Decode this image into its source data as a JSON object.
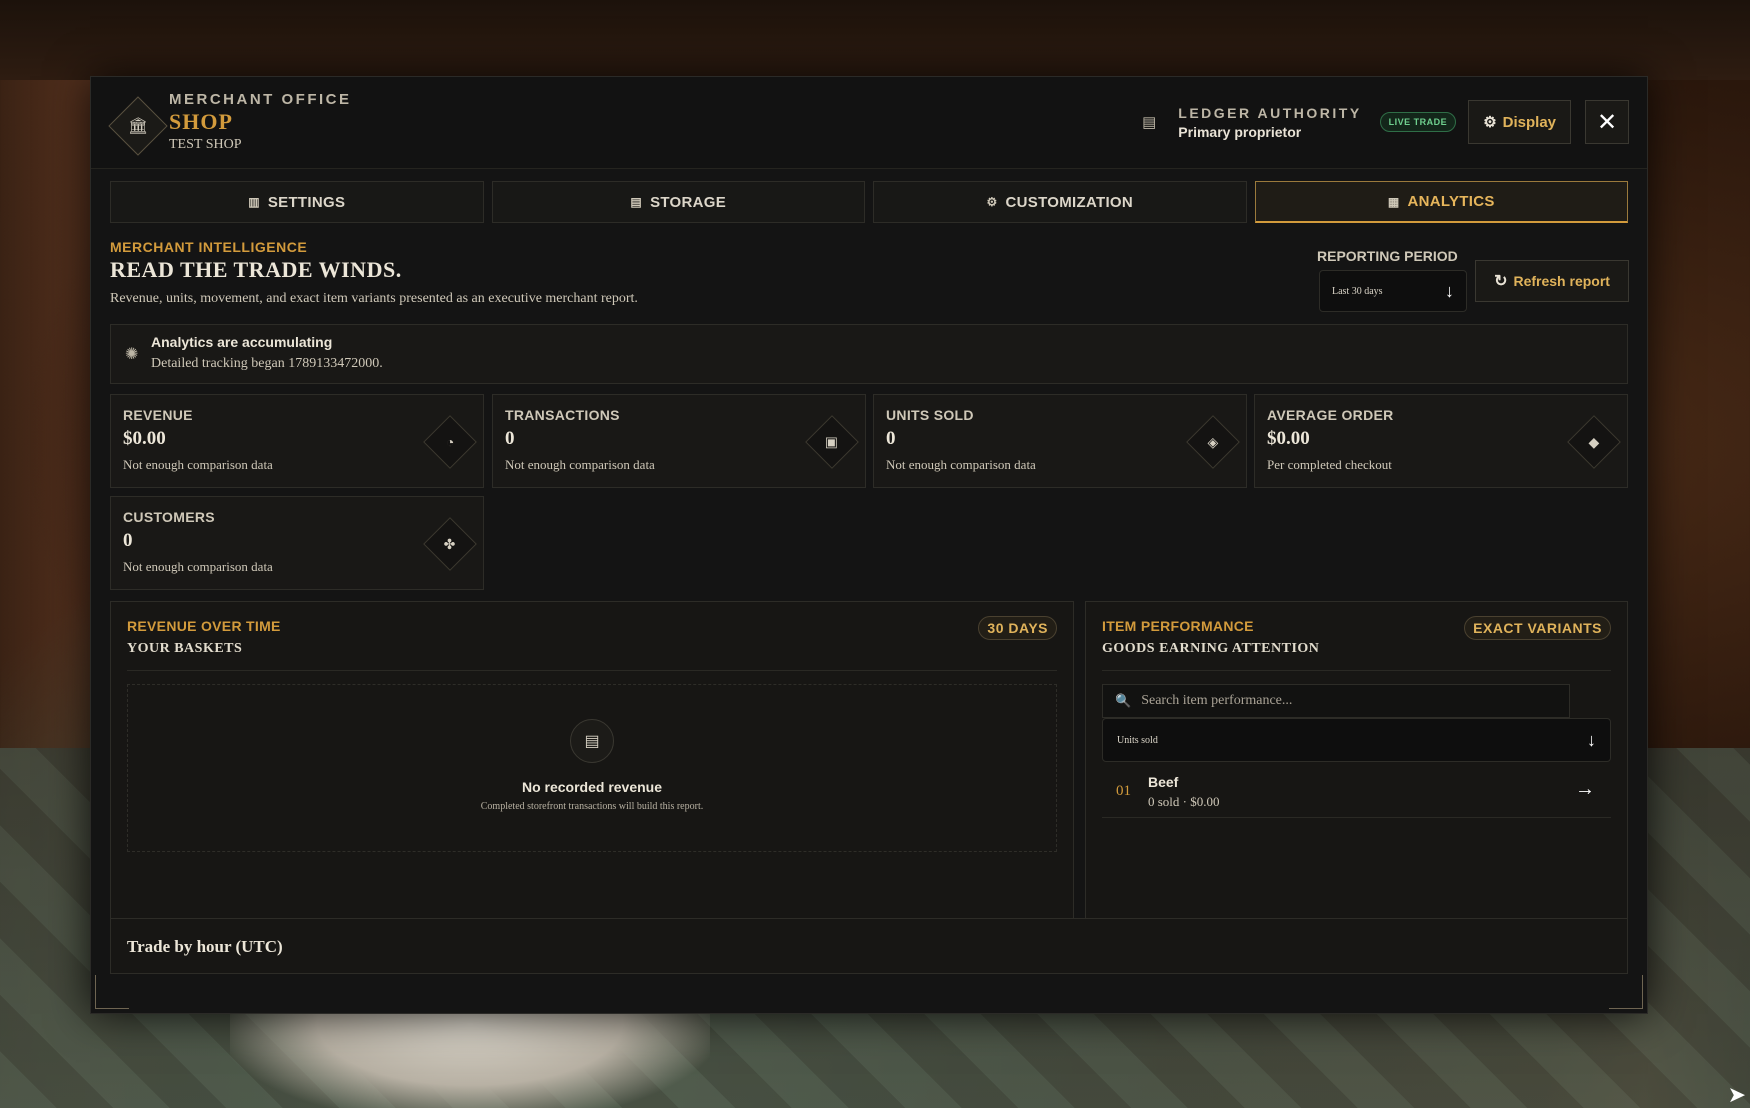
{
  "header": {
    "eyebrow": "MERCHANT OFFICE",
    "title": "SHOP",
    "subtitle": "TEST SHOP",
    "ledger_label": "LEDGER AUTHORITY",
    "ledger_role": "Primary proprietor",
    "live_badge": "LIVE TRADE",
    "display_button": "Display",
    "close_glyph": "✕"
  },
  "tabs": [
    {
      "label": "SETTINGS",
      "icon": "bar-chart-icon",
      "glyph": "📊"
    },
    {
      "label": "STORAGE",
      "icon": "box-icon",
      "glyph": "▤"
    },
    {
      "label": "CUSTOMIZATION",
      "icon": "gear-icon",
      "glyph": "⚙"
    },
    {
      "label": "ANALYTICS",
      "icon": "report-icon",
      "glyph": "▦",
      "active": true
    }
  ],
  "intro": {
    "eyebrow": "MERCHANT INTELLIGENCE",
    "title": "READ THE TRADE WINDS.",
    "description": "Revenue, units, movement, and exact item variants presented as an executive merchant report."
  },
  "period": {
    "label": "REPORTING PERIOD",
    "selected": "Last 30 days",
    "refresh_button": "Refresh report"
  },
  "notice": {
    "title": "Analytics are accumulating",
    "text": "Detailed tracking began 1789133472000."
  },
  "metrics": [
    {
      "label": "REVENUE",
      "value": "$0.00",
      "note": "Not enough comparison data",
      "icon": "coin-icon",
      "glyph": "◔"
    },
    {
      "label": "TRANSACTIONS",
      "value": "0",
      "note": "Not enough comparison data",
      "icon": "receipt-icon",
      "glyph": "▣"
    },
    {
      "label": "UNITS SOLD",
      "value": "0",
      "note": "Not enough comparison data",
      "icon": "crate-icon",
      "glyph": "◈"
    },
    {
      "label": "AVERAGE ORDER",
      "value": "$0.00",
      "note": "Per completed checkout",
      "icon": "scale-icon",
      "glyph": "◆"
    },
    {
      "label": "CUSTOMERS",
      "value": "0",
      "note": "Not enough comparison data",
      "icon": "people-icon",
      "glyph": "✤"
    }
  ],
  "revenue_panel": {
    "eyebrow": "REVENUE OVER TIME",
    "title": "YOUR BASKETS",
    "badge": "30 DAYS",
    "empty_title": "No recorded revenue",
    "empty_text": "Completed storefront transactions will build this report."
  },
  "items_panel": {
    "eyebrow": "ITEM PERFORMANCE",
    "title": "GOODS EARNING ATTENTION",
    "badge": "EXACT VARIANTS",
    "search_placeholder": "Search item performance...",
    "sort_selected": "Units sold",
    "items": [
      {
        "rank": "01",
        "name": "Beef",
        "meta": "0 sold · $0.00"
      }
    ]
  },
  "hour_panel": {
    "title": "Trade by hour (UTC)"
  },
  "colors": {
    "accent": "#d39b3c",
    "panel_bg": "#141414",
    "live_green": "#6fd08f"
  }
}
